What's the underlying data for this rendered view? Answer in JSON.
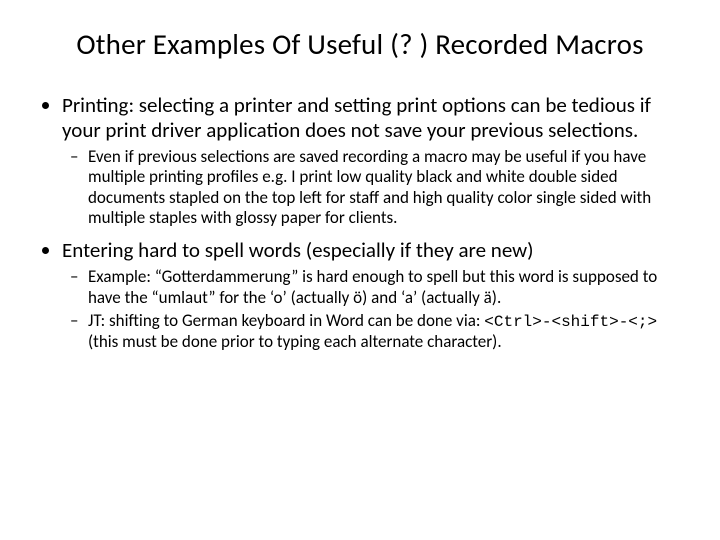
{
  "title": "Other Examples Of Useful (? ) Recorded Macros",
  "bullets": [
    {
      "text": "Printing: selecting a printer and setting print options can be tedious if your print driver application does not save your previous selections.",
      "sub": [
        "Even if previous selections are saved recording a macro may be useful if you have multiple printing profiles e.g. I print low quality black and white double sided documents stapled on the top left for staff and high quality color single sided with multiple staples with glossy paper for clients."
      ]
    },
    {
      "text": "Entering hard to spell words (especially if they are new)",
      "sub": [
        "Example: “Gotterdammerung” is hard enough to spell but this word is supposed to have the “umlaut” for the ‘o’ (actually ö) and ‘a’ (actually ä)."
      ],
      "sub_mixed": {
        "prefix": "JT: shifting to German keyboard in Word can be  done via: ",
        "code": "<Ctrl>-<shift>-<;>",
        "suffix": " (this must be done prior to typing each alternate character)."
      }
    }
  ]
}
